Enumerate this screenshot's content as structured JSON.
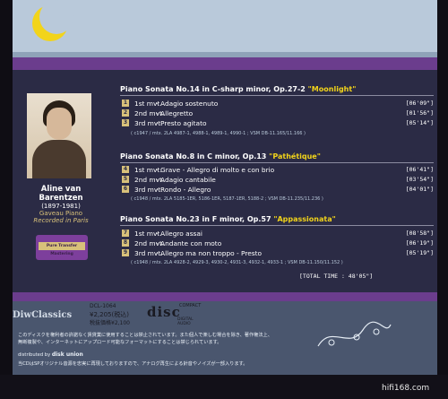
{
  "artist": {
    "name": "Aline van Barentzen",
    "years": "(1897-1981)",
    "piano": "Gaveau Piano",
    "recorded": "Recorded in Paris"
  },
  "badge": {
    "text": "Pure Transfer Mastering"
  },
  "sonatas": [
    {
      "title_prefix": "Piano Sonata No.14 in C-sharp minor, Op.27-2 ",
      "title_highlight": "\"Moonlight\"",
      "movements": [
        {
          "num": "1",
          "mvt": "1st mvt.",
          "tempo": "- Adagio sostenuto",
          "time": "[06'09\"]"
        },
        {
          "num": "2",
          "mvt": "2nd mvt.",
          "tempo": "- Allegretto",
          "time": "[01'56\"]"
        },
        {
          "num": "3",
          "mvt": "3rd mvt.",
          "tempo": "- Presto agitato",
          "time": "[05'14\"]"
        }
      ],
      "note": "( c1947 / mtx. 2LA 4987-1, 4988-1, 4989-1, 4990-1 ; VSM DB-11.165/11.166 )"
    },
    {
      "title_prefix": "Piano Sonata No.8 in C minor, Op.13 ",
      "title_highlight": "\"Pathétique\"",
      "movements": [
        {
          "num": "4",
          "mvt": "1st mvt.",
          "tempo": "- Grave - Allegro di molto e con brio",
          "time": "[06'41\"]"
        },
        {
          "num": "5",
          "mvt": "2nd mvt.",
          "tempo": "- Adagio cantabile",
          "time": "[03'54\"]"
        },
        {
          "num": "6",
          "mvt": "3rd mvt.",
          "tempo": "- Rondo - Allegro",
          "time": "[04'01\"]"
        }
      ],
      "note": "( c1948 / mtx. 2LA 5185-1ER, 5186-1ER, 5187-1ER, 5188-2 ; VSM DB-11.235/11.236 )"
    },
    {
      "title_prefix": "Piano Sonata No.23 in F minor, Op.57 ",
      "title_highlight": "\"Appassionata\"",
      "movements": [
        {
          "num": "7",
          "mvt": "1st mvt.",
          "tempo": "- Allegro assai",
          "time": "[08'58\"]"
        },
        {
          "num": "8",
          "mvt": "2nd mvt.",
          "tempo": "- Andante con moto",
          "time": "[06'19\"]"
        },
        {
          "num": "9",
          "mvt": "3rd mvt.",
          "tempo": "- Allegro  ma non troppo - Presto",
          "time": "[05'19\"]"
        }
      ],
      "note": "( c1948 / mtx. 2LA 4928-2, 4929-3, 4930-2, 4931-3, 4932-1, 4933-1 ; VSM DB-11.150/11.152 )"
    }
  ],
  "total_time": "[TOTAL TIME : 48'05\"]",
  "label": {
    "brand": "DiwClassics",
    "code": "DCL-1064",
    "price": "¥2,205(税込)",
    "price_excl": "税抜価格¥2,100",
    "disc_logo": "disc",
    "compact": "COMPACT",
    "digital_audio": "DIGITAL AUDIO"
  },
  "notice": {
    "line1": "このディスクを権利者の許諾なく賃貸業に使用することは禁止されています。また個人で楽しむ場合を除き、著作権法上、",
    "line2": "無断複製や、インターネットにアップロード可能なフォーマットにすることは禁じられています。",
    "distributed_prefix": "distributed by",
    "distributor": "disk union",
    "line3": "当CDはSPオリジナル音源を忠実に再現しておりますので、アナログ再生による針音やノイズが一部入ります。"
  },
  "watermark": "hifi168.com",
  "colors": {
    "moon": "#f2d41a",
    "highlight": "#f2d41a",
    "purple": "#6b3d8d",
    "gold": "#d8c17a"
  }
}
